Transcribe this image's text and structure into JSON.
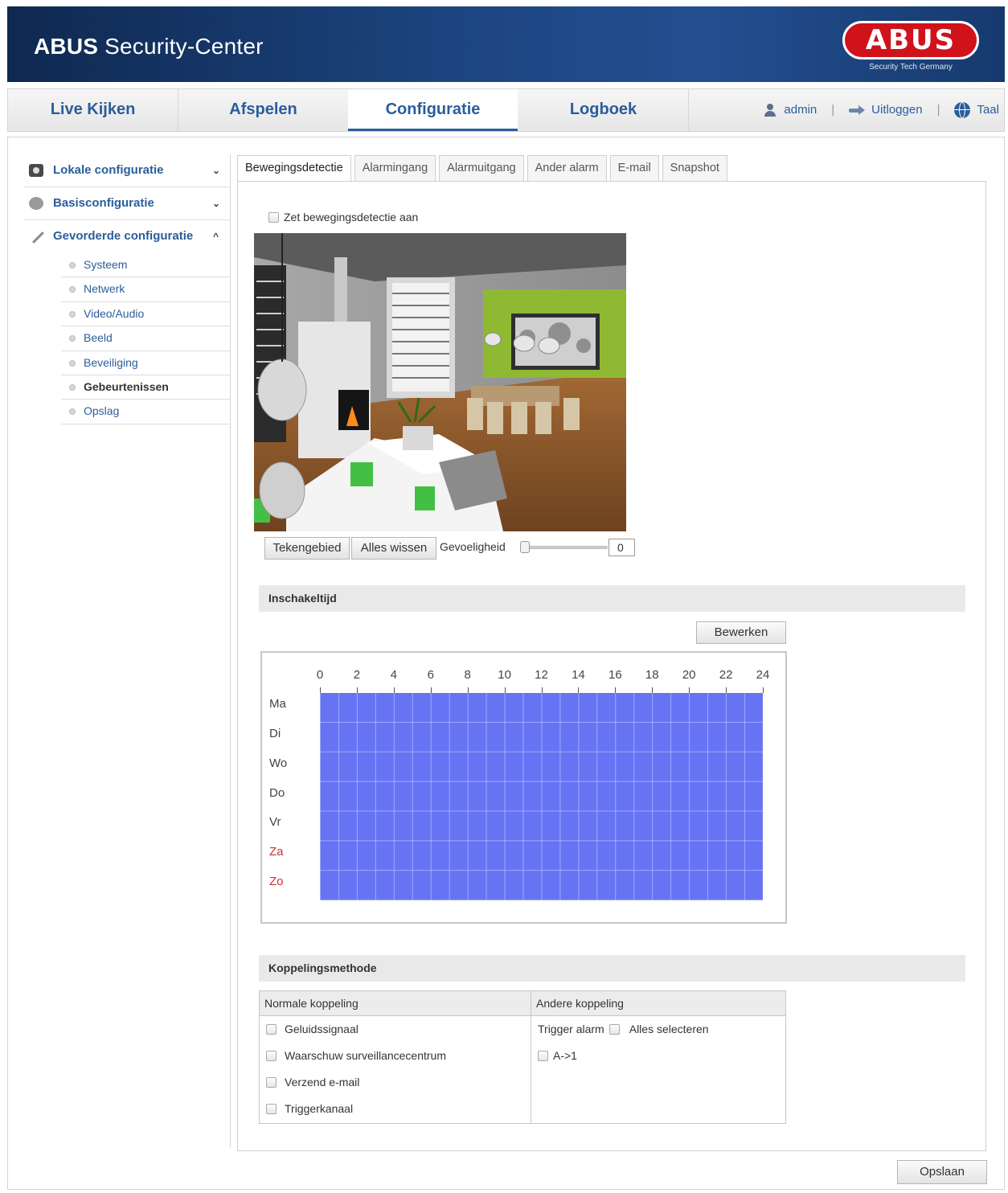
{
  "header": {
    "title_bold": "ABUS",
    "title_rest": " Security-Center",
    "logo_text": "ABUS",
    "logo_tagline": "Security Tech Germany"
  },
  "topnav": {
    "tabs": [
      {
        "label": "Live Kijken"
      },
      {
        "label": "Afspelen"
      },
      {
        "label": "Configuratie"
      },
      {
        "label": "Logboek"
      }
    ],
    "active_tab": "Configuratie",
    "user": "admin",
    "logout": "Uitloggen",
    "language": "Taal"
  },
  "sidebar": {
    "sections": [
      {
        "label": "Lokale configuratie",
        "chevron": "⌄",
        "icon": "camera-icon"
      },
      {
        "label": "Basisconfiguratie",
        "chevron": "⌄",
        "icon": "gear-icon"
      },
      {
        "label": "Gevorderde configuratie",
        "chevron": "^",
        "icon": "wrench-icon"
      }
    ],
    "sub_items": [
      {
        "label": "Systeem"
      },
      {
        "label": "Netwerk"
      },
      {
        "label": "Video/Audio"
      },
      {
        "label": "Beeld"
      },
      {
        "label": "Beveiliging"
      },
      {
        "label": "Gebeurtenissen"
      },
      {
        "label": "Opslag"
      }
    ],
    "active_sub": "Gebeurtenissen"
  },
  "subtabs": {
    "items": [
      {
        "label": "Bewegingsdetectie"
      },
      {
        "label": "Alarmingang"
      },
      {
        "label": "Alarmuitgang"
      },
      {
        "label": "Ander alarm"
      },
      {
        "label": "E-mail"
      },
      {
        "label": "Snapshot"
      }
    ],
    "active": "Bewegingsdetectie"
  },
  "motion": {
    "enable_label": "Zet bewegingsdetectie aan",
    "enabled": false,
    "draw_area_button": "Tekengebied",
    "clear_all_button": "Alles wissen",
    "sensitivity_label": "Gevoeligheid",
    "sensitivity_value": "0"
  },
  "schedule": {
    "section_title": "Inschakeltijd",
    "edit_button": "Bewerken",
    "hours": [
      "0",
      "2",
      "4",
      "6",
      "8",
      "10",
      "12",
      "14",
      "16",
      "18",
      "20",
      "22",
      "24"
    ],
    "days": [
      {
        "label": "Ma",
        "weekend": false
      },
      {
        "label": "Di",
        "weekend": false
      },
      {
        "label": "Wo",
        "weekend": false
      },
      {
        "label": "Do",
        "weekend": false
      },
      {
        "label": "Vr",
        "weekend": false
      },
      {
        "label": "Za",
        "weekend": true
      },
      {
        "label": "Zo",
        "weekend": true
      }
    ],
    "active_color": "#6674f4",
    "weekend_color": "#d03030"
  },
  "linkage": {
    "section_title": "Koppelingsmethode",
    "normal_header": "Normale koppeling",
    "other_header": "Andere koppeling",
    "normal_items": [
      {
        "label": "Geluidssignaal"
      },
      {
        "label": "Waarschuw surveillancecentrum"
      },
      {
        "label": "Verzend e-mail"
      },
      {
        "label": "Triggerkanaal"
      }
    ],
    "trigger_alarm_label": "Trigger alarm",
    "select_all_label": "Alles selecteren",
    "alarm_outputs": [
      {
        "label": "A->1"
      }
    ]
  },
  "footer": {
    "save_button": "Opslaan"
  },
  "colors": {
    "header_blue": "#1c4580",
    "link_blue": "#2a5d9b",
    "logo_red": "#d0121b"
  }
}
